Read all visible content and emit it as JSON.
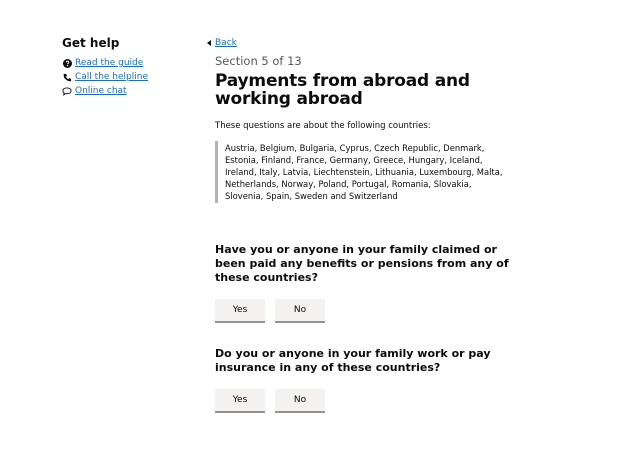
{
  "sidebar": {
    "heading": "Get help",
    "links": [
      {
        "label": "Read the guide",
        "icon": "question-circle-icon"
      },
      {
        "label": "Call the helpline",
        "icon": "phone-icon"
      },
      {
        "label": "Online chat",
        "icon": "chat-bubble-icon"
      }
    ]
  },
  "main": {
    "back_label": "Back",
    "caption": "Section 5 of 13",
    "title": "Payments from abroad and working abroad",
    "intro": "These questions are about the following countries:",
    "countries": "Austria, Belgium, Bulgaria, Cyprus, Czech Republic, Denmark, Estonia, Finland, France, Germany, Greece, Hungary, Iceland, Ireland, Italy, Latvia, Liechtenstein, Lithuania, Luxembourg, Malta, Netherlands, Norway, Poland, Portugal, Romania, Slovakia, Slovenia, Spain, Sweden and Switzerland",
    "questions": [
      {
        "text": "Have you or anyone in your family claimed or been paid any benefits or pensions from any of these countries?",
        "yes_label": "Yes",
        "no_label": "No"
      },
      {
        "text": "Do you or anyone in your family work or pay insurance in any of these countries?",
        "yes_label": "Yes",
        "no_label": "No"
      }
    ]
  },
  "colors": {
    "link": "#1d70b8",
    "text": "#0b0c0c",
    "secondary_text": "#505a5f",
    "inset_border": "#b1b4b6",
    "button_bg": "#f3f2f1"
  }
}
